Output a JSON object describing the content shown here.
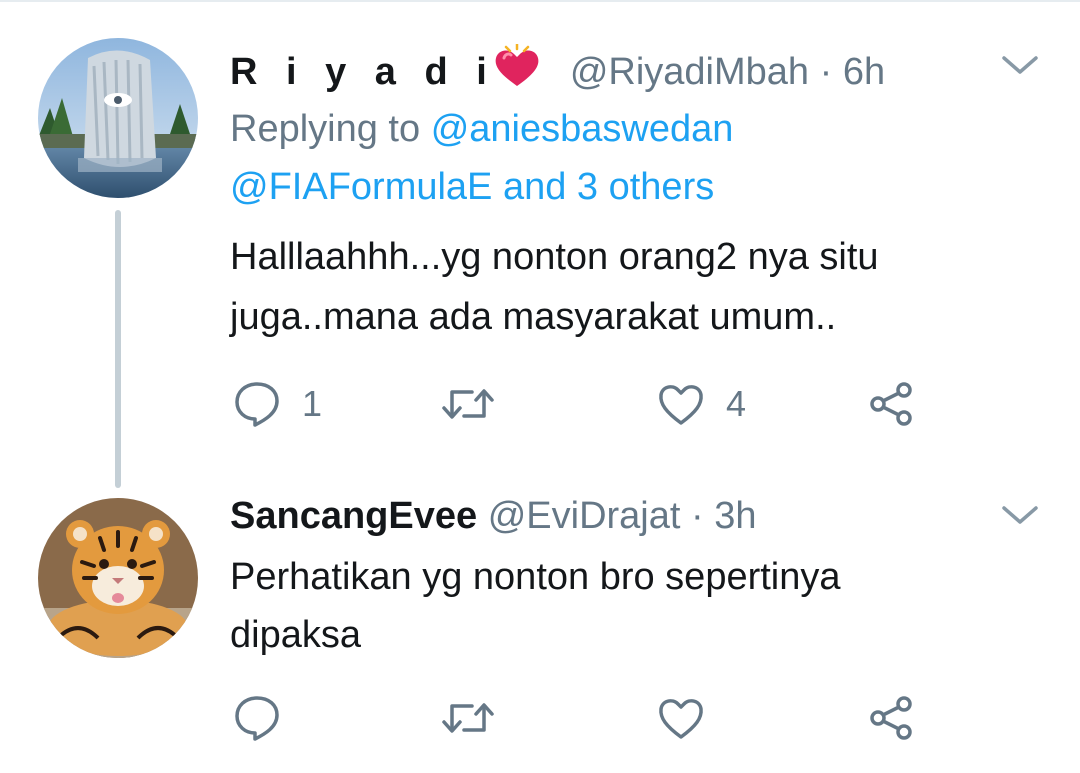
{
  "tweets": [
    {
      "display_name": "R i y a d i",
      "name_emoji": "red-heart-with-sparkles",
      "handle": "@RiyadiMbah",
      "separator": "·",
      "time": "6h",
      "replying_prefix": "Replying to",
      "replying_mention": "@aniesbaswedan",
      "replying_line2": "@FIAFormulaE and 3 others",
      "text_lines": [
        "Halllaahhh...yg nonton orang2 nya situ",
        "juga..mana ada masyarakat umum.."
      ],
      "actions": {
        "reply_icon": "speech-bubble-icon",
        "reply_count": "1",
        "retweet_icon": "retweet-arrows-icon",
        "retweet_count": "",
        "like_icon": "heart-outline-icon",
        "like_count": "4",
        "share_icon": "share-nodes-icon"
      },
      "avatar": "hand-fountain-statue-photo"
    },
    {
      "display_name": "SancangEvee",
      "handle": "@EviDrajat",
      "separator": "·",
      "time": "3h",
      "text_lines": [
        "Perhatikan yg nonton bro sepertinya",
        "dipaksa"
      ],
      "actions": {
        "reply_icon": "speech-bubble-icon",
        "reply_count": "",
        "retweet_icon": "retweet-arrows-icon",
        "retweet_count": "",
        "like_icon": "heart-outline-icon",
        "like_count": "",
        "share_icon": "share-nodes-icon"
      },
      "avatar": "tiger-cub-photo"
    }
  ],
  "colors": {
    "text": "#14171a",
    "secondary": "#657786",
    "link": "#1da1f2",
    "thread_line": "#c4cfd6",
    "emoji_heart": "#e0245e"
  }
}
